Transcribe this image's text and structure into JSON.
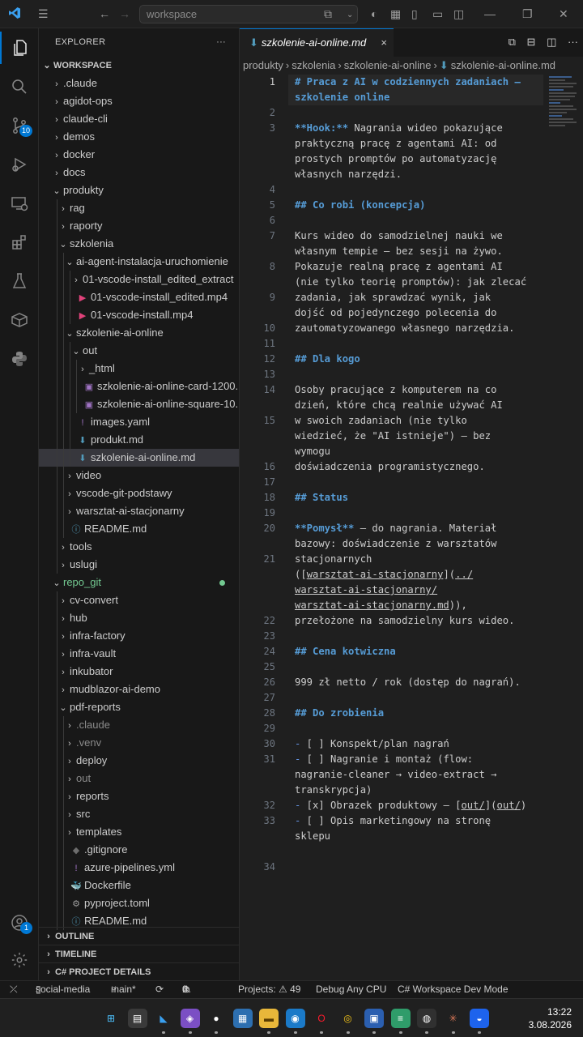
{
  "titlebar": {
    "search_placeholder": "workspace",
    "icons": [
      "vscode-logo-icon",
      "menu-icon",
      "back-arrow-icon",
      "forward-arrow-icon",
      "copilot-icon",
      "chevron-down-icon",
      "copilot-toggle-icon",
      "layout-icon",
      "panel-icon",
      "sidebar-icon",
      "minimize-icon",
      "restore-icon",
      "close-icon"
    ]
  },
  "activity": {
    "items": [
      "explorer",
      "search",
      "source-control",
      "run-debug",
      "remote-explorer",
      "extensions",
      "testing",
      "docker",
      "python"
    ],
    "scm_badge": "10",
    "account_badge": "1"
  },
  "explorer": {
    "title": "EXPLORER",
    "more": "···",
    "root": "WORKSPACE",
    "rows": [
      {
        "label": ".claude",
        "depth": 1,
        "type": "folder",
        "open": false
      },
      {
        "label": "agidot-ops",
        "depth": 1,
        "type": "folder",
        "open": false
      },
      {
        "label": "claude-cli",
        "depth": 1,
        "type": "folder",
        "open": false
      },
      {
        "label": "demos",
        "depth": 1,
        "type": "folder",
        "open": false
      },
      {
        "label": "docker",
        "depth": 1,
        "type": "folder",
        "open": false
      },
      {
        "label": "docs",
        "depth": 1,
        "type": "folder",
        "open": false
      },
      {
        "label": "produkty",
        "depth": 1,
        "type": "folder",
        "open": true
      },
      {
        "label": "rag",
        "depth": 2,
        "type": "folder",
        "open": false
      },
      {
        "label": "raporty",
        "depth": 2,
        "type": "folder",
        "open": false
      },
      {
        "label": "szkolenia",
        "depth": 2,
        "type": "folder",
        "open": true
      },
      {
        "label": "ai-agent-instalacja-uruchomienie",
        "depth": 3,
        "type": "folder",
        "open": true
      },
      {
        "label": "01-vscode-install_edited_extract",
        "depth": 4,
        "type": "folder",
        "open": false
      },
      {
        "label": "01-vscode-install_edited.mp4",
        "depth": 4,
        "type": "video"
      },
      {
        "label": "01-vscode-install.mp4",
        "depth": 4,
        "type": "video"
      },
      {
        "label": "szkolenie-ai-online",
        "depth": 3,
        "type": "folder",
        "open": true
      },
      {
        "label": "out",
        "depth": 4,
        "type": "folder",
        "open": true
      },
      {
        "label": "_html",
        "depth": 5,
        "type": "folder",
        "open": false
      },
      {
        "label": "szkolenie-ai-online-card-1200...",
        "depth": 5,
        "type": "image"
      },
      {
        "label": "szkolenie-ai-online-square-10...",
        "depth": 5,
        "type": "image"
      },
      {
        "label": "images.yaml",
        "depth": 4,
        "type": "yaml"
      },
      {
        "label": "produkt.md",
        "depth": 4,
        "type": "md"
      },
      {
        "label": "szkolenie-ai-online.md",
        "depth": 4,
        "type": "md",
        "selected": true
      },
      {
        "label": "video",
        "depth": 3,
        "type": "folder",
        "open": false
      },
      {
        "label": "vscode-git-podstawy",
        "depth": 3,
        "type": "folder",
        "open": false
      },
      {
        "label": "warsztat-ai-stacjonarny",
        "depth": 3,
        "type": "folder",
        "open": false
      },
      {
        "label": "README.md",
        "depth": 3,
        "type": "info"
      },
      {
        "label": "tools",
        "depth": 2,
        "type": "folder",
        "open": false
      },
      {
        "label": "uslugi",
        "depth": 2,
        "type": "folder",
        "open": false
      },
      {
        "label": "repo_git",
        "depth": 1,
        "type": "folder",
        "open": true,
        "git": true
      },
      {
        "label": "cv-convert",
        "depth": 2,
        "type": "folder",
        "open": false
      },
      {
        "label": "hub",
        "depth": 2,
        "type": "folder",
        "open": false
      },
      {
        "label": "infra-factory",
        "depth": 2,
        "type": "folder",
        "open": false
      },
      {
        "label": "infra-vault",
        "depth": 2,
        "type": "folder",
        "open": false
      },
      {
        "label": "inkubator",
        "depth": 2,
        "type": "folder",
        "open": false
      },
      {
        "label": "mudblazor-ai-demo",
        "depth": 2,
        "type": "folder",
        "open": false
      },
      {
        "label": "pdf-reports",
        "depth": 2,
        "type": "folder",
        "open": true
      },
      {
        "label": ".claude",
        "depth": 3,
        "type": "folder",
        "open": false,
        "dim": true
      },
      {
        "label": ".venv",
        "depth": 3,
        "type": "folder",
        "open": false,
        "dim": true
      },
      {
        "label": "deploy",
        "depth": 3,
        "type": "folder",
        "open": false
      },
      {
        "label": "out",
        "depth": 3,
        "type": "folder",
        "open": false,
        "dim": true
      },
      {
        "label": "reports",
        "depth": 3,
        "type": "folder",
        "open": false
      },
      {
        "label": "src",
        "depth": 3,
        "type": "folder",
        "open": false
      },
      {
        "label": "templates",
        "depth": 3,
        "type": "folder",
        "open": false
      },
      {
        "label": ".gitignore",
        "depth": 3,
        "type": "git"
      },
      {
        "label": "azure-pipelines.yml",
        "depth": 3,
        "type": "yaml"
      },
      {
        "label": "Dockerfile",
        "depth": 3,
        "type": "docker"
      },
      {
        "label": "pyproject.toml",
        "depth": 3,
        "type": "gear"
      },
      {
        "label": "README.md",
        "depth": 3,
        "type": "info"
      }
    ],
    "panels": [
      "OUTLINE",
      "TIMELINE",
      "C# PROJECT DETAILS"
    ]
  },
  "editor": {
    "tab_label": "szkolenie-ai-online.md",
    "tab_close": "×",
    "breadcrumbs": [
      "produkty",
      "szkolenia",
      "szkolenie-ai-online",
      "szkolenie-ai-online.md"
    ],
    "lines": [
      {
        "n": "1",
        "segs": [
          {
            "t": "# Praca z AI w codziennych zadaniach —",
            "c": "h"
          }
        ]
      },
      {
        "n": "",
        "segs": [
          {
            "t": "szkolenie online",
            "c": "h"
          }
        ]
      },
      {
        "n": "2",
        "segs": []
      },
      {
        "n": "3",
        "segs": [
          {
            "t": "**Hook:**",
            "c": "b"
          },
          {
            "t": " Nagrania wideo pokazujące"
          }
        ]
      },
      {
        "n": "",
        "segs": [
          {
            "t": "praktyczną pracę z agentami AI: od"
          }
        ]
      },
      {
        "n": "",
        "segs": [
          {
            "t": "prostych promptów po automatyzację"
          }
        ]
      },
      {
        "n": "",
        "segs": [
          {
            "t": "własnych narzędzi."
          }
        ]
      },
      {
        "n": "4",
        "segs": []
      },
      {
        "n": "5",
        "segs": [
          {
            "t": "## Co robi (koncepcja)",
            "c": "h"
          }
        ]
      },
      {
        "n": "6",
        "segs": []
      },
      {
        "n": "7",
        "segs": [
          {
            "t": "Kurs wideo do samodzielnej nauki we"
          }
        ]
      },
      {
        "n": "",
        "segs": [
          {
            "t": "własnym tempie — bez sesji na żywo."
          }
        ]
      },
      {
        "n": "8",
        "segs": [
          {
            "t": "Pokazuje realną pracę z agentami AI"
          }
        ]
      },
      {
        "n": "",
        "segs": [
          {
            "t": "(nie tylko teorię promptów): jak zlecać"
          }
        ]
      },
      {
        "n": "9",
        "segs": [
          {
            "t": "zadania, jak sprawdzać wynik, jak"
          }
        ]
      },
      {
        "n": "",
        "segs": [
          {
            "t": "dojść od pojedynczego polecenia do"
          }
        ]
      },
      {
        "n": "10",
        "segs": [
          {
            "t": "zautomatyzowanego własnego narzędzia."
          }
        ]
      },
      {
        "n": "11",
        "segs": []
      },
      {
        "n": "12",
        "segs": [
          {
            "t": "## Dla kogo",
            "c": "h"
          }
        ]
      },
      {
        "n": "13",
        "segs": []
      },
      {
        "n": "14",
        "segs": [
          {
            "t": "Osoby pracujące z komputerem na co"
          }
        ]
      },
      {
        "n": "",
        "segs": [
          {
            "t": "dzień, które chcą realnie używać AI"
          }
        ]
      },
      {
        "n": "15",
        "segs": [
          {
            "t": "w swoich zadaniach (nie tylko"
          }
        ]
      },
      {
        "n": "",
        "segs": [
          {
            "t": "wiedzieć, że \"AI istnieje\") — bez"
          }
        ]
      },
      {
        "n": "",
        "segs": [
          {
            "t": "wymogu"
          }
        ]
      },
      {
        "n": "16",
        "segs": [
          {
            "t": "doświadczenia programistycznego."
          }
        ]
      },
      {
        "n": "17",
        "segs": []
      },
      {
        "n": "18",
        "segs": [
          {
            "t": "## Status",
            "c": "h"
          }
        ]
      },
      {
        "n": "19",
        "segs": []
      },
      {
        "n": "20",
        "segs": [
          {
            "t": "**Pomysł**",
            "c": "b"
          },
          {
            "t": " — do nagrania. Materiał"
          }
        ]
      },
      {
        "n": "",
        "segs": [
          {
            "t": "bazowy: doświadczenie z warsztatów"
          }
        ]
      },
      {
        "n": "21",
        "segs": [
          {
            "t": "stacjonarnych"
          }
        ]
      },
      {
        "n": "",
        "segs": [
          {
            "t": "(["
          },
          {
            "t": "warsztat-ai-stacjonarny",
            "c": "lnk"
          },
          {
            "t": "]("
          },
          {
            "t": "../",
            "c": "lnk"
          }
        ]
      },
      {
        "n": "",
        "segs": [
          {
            "t": "warsztat-ai-stacjonarny/",
            "c": "lnk"
          }
        ]
      },
      {
        "n": "",
        "segs": [
          {
            "t": "warsztat-ai-stacjonarny.md",
            "c": "lnk"
          },
          {
            "t": ")),"
          }
        ]
      },
      {
        "n": "22",
        "segs": [
          {
            "t": "przełożone na samodzielny kurs wideo."
          }
        ]
      },
      {
        "n": "23",
        "segs": []
      },
      {
        "n": "24",
        "segs": [
          {
            "t": "## Cena kotwiczna",
            "c": "h"
          }
        ]
      },
      {
        "n": "25",
        "segs": []
      },
      {
        "n": "26",
        "segs": [
          {
            "t": "999 zł netto / rok (dostęp do nagrań)."
          }
        ]
      },
      {
        "n": "27",
        "segs": []
      },
      {
        "n": "28",
        "segs": [
          {
            "t": "## Do zrobienia",
            "c": "h"
          }
        ]
      },
      {
        "n": "29",
        "segs": []
      },
      {
        "n": "30",
        "segs": [
          {
            "t": "-",
            "c": "lst"
          },
          {
            "t": " [ ] Konspekt/plan nagrań"
          }
        ]
      },
      {
        "n": "31",
        "segs": [
          {
            "t": "-",
            "c": "lst"
          },
          {
            "t": " [ ] Nagranie i montaż (flow:"
          }
        ]
      },
      {
        "n": "",
        "segs": [
          {
            "t": "nagranie-cleaner → video-extract →"
          }
        ]
      },
      {
        "n": "",
        "segs": [
          {
            "t": "transkrypcja)"
          }
        ]
      },
      {
        "n": "32",
        "segs": [
          {
            "t": "-",
            "c": "lst"
          },
          {
            "t": " [x] Obrazek produktowy — ["
          },
          {
            "t": "out/",
            "c": "lnk"
          },
          {
            "t": "]("
          },
          {
            "t": "out/",
            "c": "lnk"
          },
          {
            "t": ")"
          }
        ]
      },
      {
        "n": "33",
        "segs": [
          {
            "t": "-",
            "c": "lst"
          },
          {
            "t": " [ ] Opis marketingowy na stronę"
          }
        ]
      },
      {
        "n": "",
        "segs": [
          {
            "t": "sklepu"
          }
        ]
      },
      {
        "n": "",
        "segs": []
      },
      {
        "n": "34",
        "segs": []
      }
    ]
  },
  "statusbar": {
    "remote": "⤫",
    "repo": "social-media",
    "branch": "main*",
    "sync": "⟳",
    "errors": "0",
    "warnings": "0",
    "projects": "Projects: ⚠ 49",
    "debug": "Debug Any CPU",
    "workspace_mode": "C# Workspace Dev Mode"
  },
  "taskbar": {
    "apps": [
      "windows-start-icon",
      "file-explorer-app-icon",
      "vscode-app-icon",
      "visual-studio-app-icon",
      "github-app-icon",
      "store-app-icon",
      "folder-app-icon",
      "edge-app-icon",
      "opera-app-icon",
      "chrome-app-icon",
      "remote-desktop-app-icon",
      "notepad-app-icon",
      "obs-app-icon",
      "claude-app-icon",
      "docker-app-icon"
    ],
    "time": "13:22",
    "date": "3.08.2026"
  },
  "colors": {
    "accent": "#0078d4",
    "heading": "#569cd6",
    "git_added": "#73c991",
    "video_icon": "#e0427a",
    "image_icon": "#a074c4"
  }
}
